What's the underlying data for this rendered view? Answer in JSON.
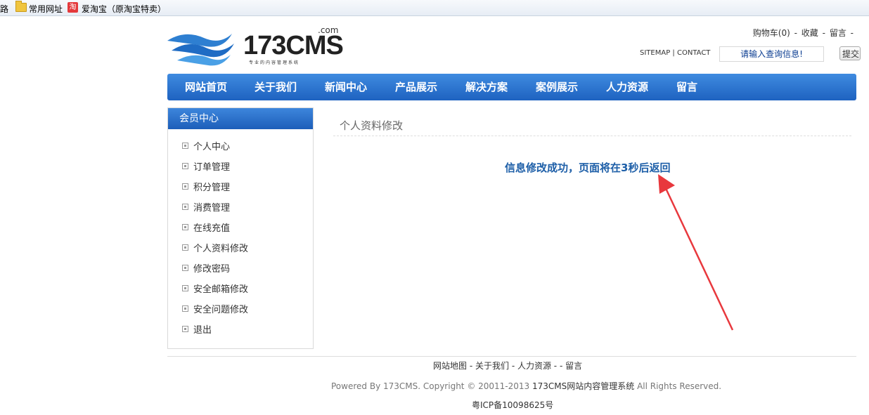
{
  "bookmarks": {
    "partial": "路",
    "folder_label": "常用网址",
    "taobao_icon_text": "淘",
    "taobao_label": "爱淘宝（原淘宝特卖）"
  },
  "header": {
    "logo_text": "173CMS",
    "logo_com": ".com",
    "logo_sub": "专业的内容管理系统",
    "cart": "购物车(0)",
    "favorite": "收藏",
    "message": "留言",
    "sep": "-",
    "sitemap": "SITEMAP",
    "contact": "CONTACT",
    "util_sep": "|",
    "search_placeholder": "请输入查询信息!",
    "submit": "提交"
  },
  "nav": [
    "网站首页",
    "关于我们",
    "新闻中心",
    "产品展示",
    "解决方案",
    "案例展示",
    "人力资源",
    "留言"
  ],
  "sidebar": {
    "title": "会员中心",
    "items": [
      "个人中心",
      "订单管理",
      "积分管理",
      "消费管理",
      "在线充值",
      "个人资料修改",
      "修改密码",
      "安全邮箱修改",
      "安全问题修改",
      "退出"
    ]
  },
  "main": {
    "title": "个人资料修改",
    "message": "信息修改成功，页面将在3秒后返回"
  },
  "footer": {
    "links": [
      "网站地图",
      "关于我们",
      "人力资源",
      "",
      "留言"
    ],
    "sep": " - ",
    "copyright_prefix": "Powered By 173CMS. Copyright © 20011-2013 ",
    "copyright_brand": "173CMS网站内容管理系统",
    "copyright_suffix": " All Rights Reserved.",
    "icp": "粤ICP备10098625号"
  },
  "colors": {
    "nav_blue": "#2a72d0",
    "message_blue": "#1e5fa8",
    "arrow_red": "#e8383d"
  }
}
